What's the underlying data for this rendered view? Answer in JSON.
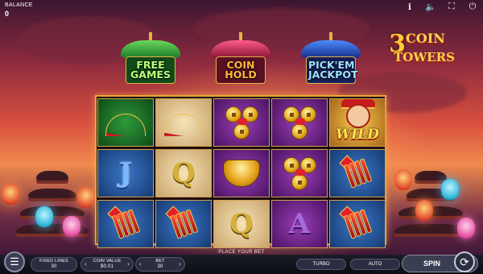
{
  "topbar": {
    "balance_label": "BALANCE",
    "balance_value": "0",
    "icons": [
      "info-icon",
      "sound-icon",
      "fullscreen-icon",
      "power-icon"
    ]
  },
  "logo": {
    "number": "3",
    "word1": "COIN",
    "word2": "TOWERS"
  },
  "features": [
    {
      "line1": "FREE",
      "line2": "GAMES",
      "color": "#6ad85a"
    },
    {
      "line1": "COIN",
      "line2": "HOLD",
      "color": "#ff5a8a"
    },
    {
      "line1": "PICK'EM",
      "line2": "JACKPOT",
      "color": "#4a8cff"
    }
  ],
  "reels": [
    [
      "fan",
      "fan",
      "coins",
      "coins",
      "wild"
    ],
    [
      "J",
      "Q",
      "gold-boat",
      "coins",
      "firecrackers"
    ],
    [
      "firecrackers",
      "firecrackers",
      "Q",
      "A",
      "firecrackers"
    ]
  ],
  "wild_label": "WILD",
  "message": "PLACE YOUR BET",
  "controls": {
    "fixed_lines_label": "FIXED LINES",
    "fixed_lines_value": "30",
    "coin_value_label": "COIN VALUE",
    "coin_value_value": "$0.01",
    "bet_label": "BET",
    "bet_value": "30",
    "turbo_label": "TURBO",
    "auto_label": "AUTO",
    "spin_label": "SPIN"
  }
}
